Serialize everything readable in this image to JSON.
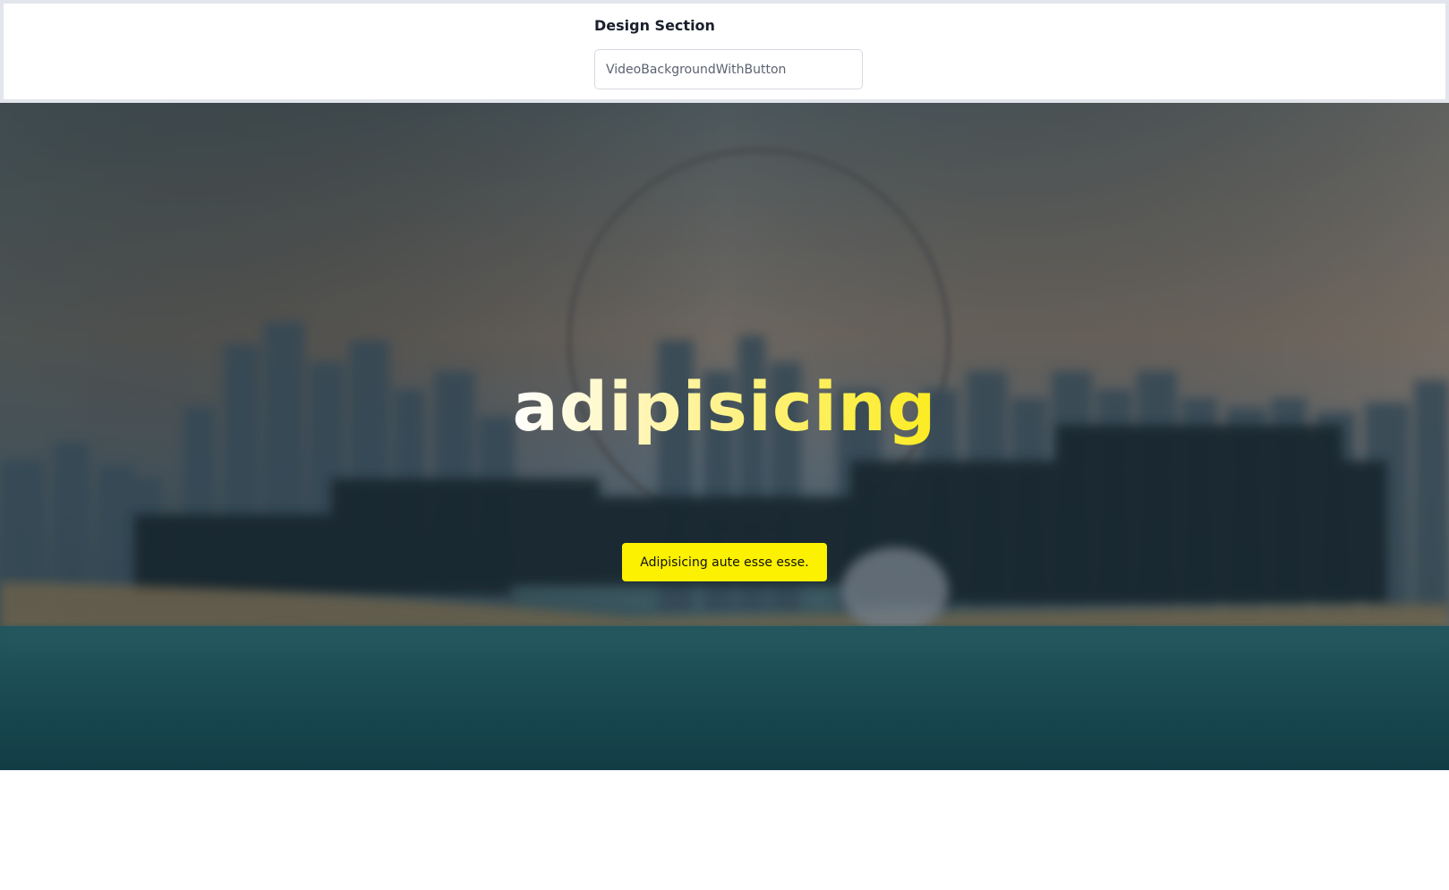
{
  "design_section": {
    "title": "Design Section",
    "selected_value": "VideoBackgroundWithButton"
  },
  "hero": {
    "title": "adipisicing",
    "button_label": "Adipisicing aute esse esse.",
    "button_color": "#fcf100",
    "title_gradient": [
      "#ffffff",
      "#fcec20"
    ]
  }
}
